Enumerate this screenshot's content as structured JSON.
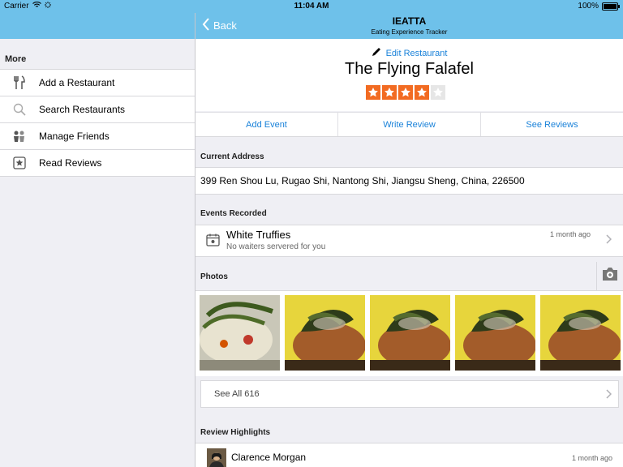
{
  "status_bar": {
    "carrier": "Carrier",
    "time": "11:04 AM",
    "battery": "100%"
  },
  "sidebar": {
    "section_title": "More",
    "items": [
      {
        "label": "Add a Restaurant",
        "icon": "fork-knife-icon"
      },
      {
        "label": "Search Restaurants",
        "icon": "search-icon"
      },
      {
        "label": "Manage Friends",
        "icon": "friends-icon"
      },
      {
        "label": "Read Reviews",
        "icon": "star-box-icon"
      }
    ]
  },
  "navbar": {
    "back_label": "Back",
    "title": "IEATTA",
    "subtitle": "Eating Experience Tracker"
  },
  "restaurant": {
    "edit_label": "Edit Restaurant",
    "name": "The Flying Falafel",
    "rating": 4,
    "rating_max": 5
  },
  "actions": [
    "Add Event",
    "Write Review",
    "See Reviews"
  ],
  "address": {
    "section_title": "Current Address",
    "value": "399 Ren Shou Lu, Rugao Shi, Nantong Shi, Jiangsu Sheng, China, 226500"
  },
  "events": {
    "section_title": "Events Recorded",
    "items": [
      {
        "title": "White Truffies",
        "subtitle": "No waiters servered for you",
        "time": "1 month ago"
      }
    ]
  },
  "photos": {
    "section_title": "Photos",
    "count": 5,
    "see_all_label": "See All 616"
  },
  "reviews": {
    "section_title": "Review Highlights",
    "items": [
      {
        "name": "Clarence Morgan",
        "time": "1 month ago"
      }
    ]
  },
  "colors": {
    "bar": "#6ec1ea",
    "link": "#1a82d9",
    "star": "#f26b22",
    "background": "#efeff4"
  }
}
